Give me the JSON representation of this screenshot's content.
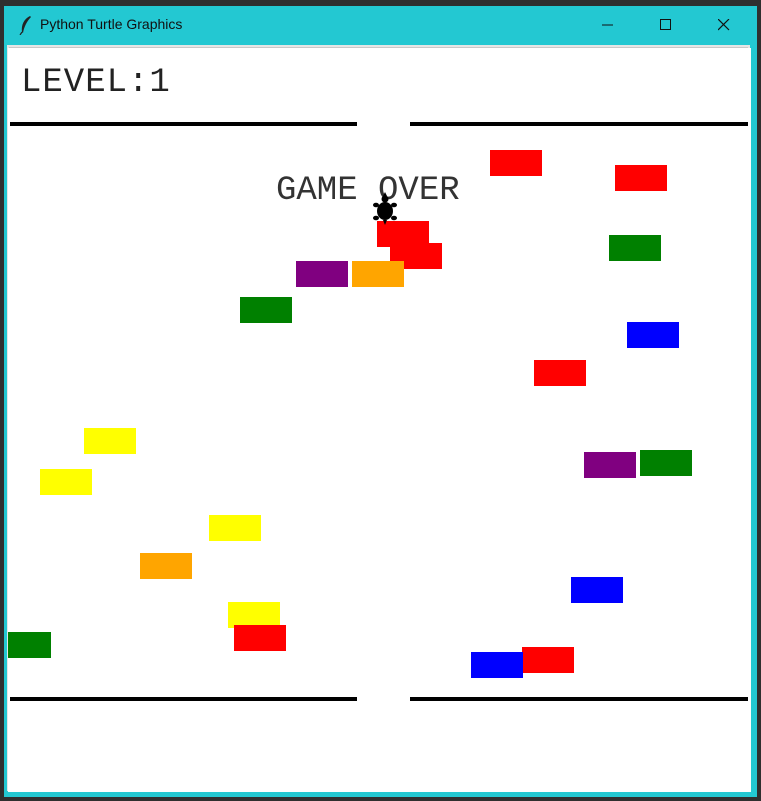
{
  "window": {
    "title": "Python Turtle Graphics",
    "icon": "feather-icon",
    "controls": [
      "minimize-icon",
      "maximize-icon",
      "close-icon"
    ]
  },
  "game": {
    "level_text": "LEVEL:1",
    "status_text": "GAME OVER",
    "player": "turtle-icon",
    "colors": {
      "red": "#ff0000",
      "green": "#008000",
      "purple": "#800080",
      "orange": "#ffa500",
      "yellow": "#ffff00",
      "blue": "#0000ff"
    }
  }
}
